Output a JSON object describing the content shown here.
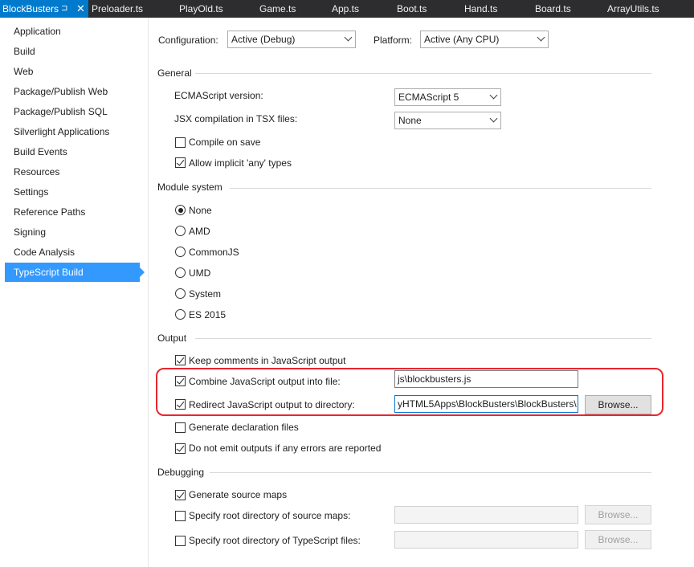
{
  "tabs": [
    {
      "label": "BlockBusters",
      "active": true
    },
    {
      "label": "Preloader.ts"
    },
    {
      "label": "PlayOld.ts"
    },
    {
      "label": "Game.ts"
    },
    {
      "label": "App.ts"
    },
    {
      "label": "Boot.ts"
    },
    {
      "label": "Hand.ts"
    },
    {
      "label": "Board.ts"
    },
    {
      "label": "ArrayUtils.ts"
    }
  ],
  "tab_icons": {
    "pin": "⊐",
    "close": "✕"
  },
  "sidebar": {
    "items": [
      "Application",
      "Build",
      "Web",
      "Package/Publish Web",
      "Package/Publish SQL",
      "Silverlight Applications",
      "Build Events",
      "Resources",
      "Settings",
      "Reference Paths",
      "Signing",
      "Code Analysis",
      "TypeScript Build"
    ],
    "selected": "TypeScript Build"
  },
  "config": {
    "configuration_label": "Configuration:",
    "configuration_value": "Active (Debug)",
    "platform_label": "Platform:",
    "platform_value": "Active (Any CPU)"
  },
  "general": {
    "title": "General",
    "ecma_label": "ECMAScript version:",
    "ecma_value": "ECMAScript 5",
    "jsx_label": "JSX compilation in TSX files:",
    "jsx_value": "None",
    "compile_on_save": "Compile on save",
    "allow_implicit_any": "Allow implicit 'any' types"
  },
  "module": {
    "title": "Module system",
    "options": [
      "None",
      "AMD",
      "CommonJS",
      "UMD",
      "System",
      "ES 2015"
    ],
    "selected": "None"
  },
  "output": {
    "title": "Output",
    "keep_comments": "Keep comments in JavaScript output",
    "combine_label": "Combine JavaScript output into file:",
    "combine_value": "js\\blockbusters.js",
    "redirect_label": "Redirect JavaScript output to directory:",
    "redirect_value": "yHTML5Apps\\BlockBusters\\BlockBusters\\",
    "browse": "Browse...",
    "gen_declaration": "Generate declaration files",
    "no_emit_on_error": "Do not emit outputs if any errors are reported"
  },
  "debugging": {
    "title": "Debugging",
    "gen_source_maps": "Generate source maps",
    "root_source_maps": "Specify root directory of source maps:",
    "root_ts_files": "Specify root directory of TypeScript files:",
    "browse": "Browse..."
  },
  "colors": {
    "tab_bar": "#2d2d30",
    "active_tab": "#007acc",
    "selected_item": "#3399ff",
    "highlight": "#e8262e"
  }
}
